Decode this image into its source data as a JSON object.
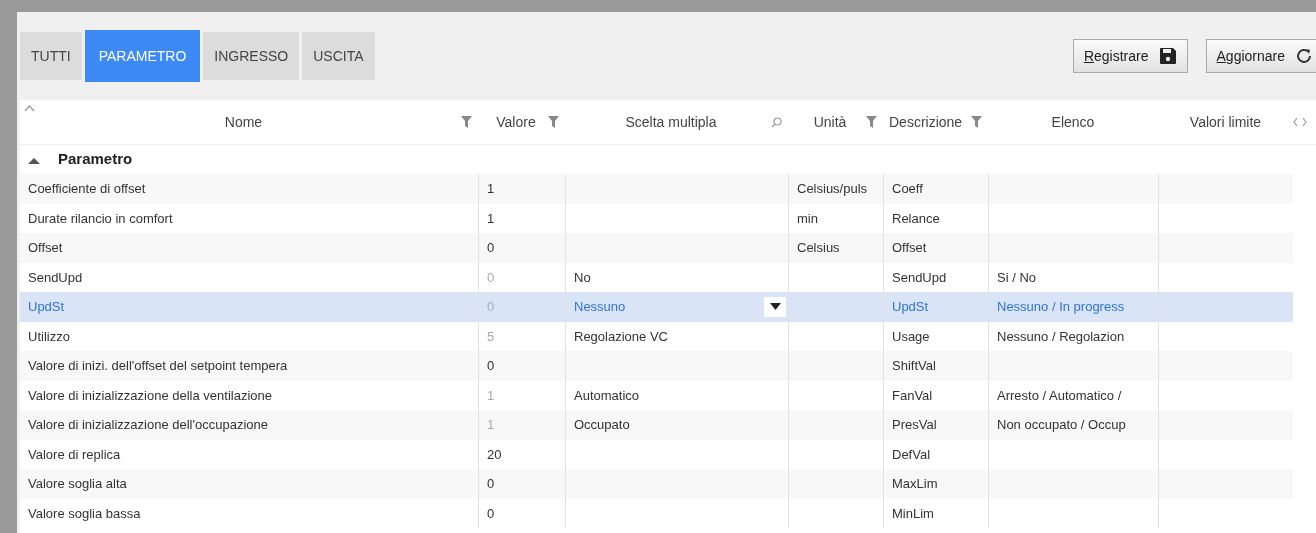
{
  "tabs": [
    {
      "label": "TUTTI",
      "selected": false
    },
    {
      "label": "PARAMETRO",
      "selected": true
    },
    {
      "label": "INGRESSO",
      "selected": false
    },
    {
      "label": "USCITA",
      "selected": false
    }
  ],
  "actions": [
    {
      "label": "Registrare",
      "kind": "save"
    },
    {
      "label": "Aggiornare",
      "kind": "refresh"
    }
  ],
  "table": {
    "columns": [
      {
        "label": "Nome",
        "kind": "filter"
      },
      {
        "label": "Valore",
        "kind": "filter"
      },
      {
        "label": "Scelta multipla",
        "kind": "search"
      },
      {
        "label": "Unità",
        "kind": "filter"
      },
      {
        "label": "Descrizione",
        "kind": "filter"
      },
      {
        "label": "Elenco",
        "kind": "plain"
      },
      {
        "label": "Valori limite",
        "kind": "plain"
      }
    ],
    "group": {
      "label": "Parametro",
      "expanded": true
    },
    "rows": [
      {
        "cells": [
          "Coefficiente di offset",
          "1",
          "",
          "Celsius/puls",
          "Coeff",
          "",
          ""
        ],
        "dimmed": false,
        "selected": false
      },
      {
        "cells": [
          "Durate rilancio in comfort",
          "1",
          "",
          "min",
          "Relance",
          "",
          ""
        ],
        "dimmed": false,
        "selected": false
      },
      {
        "cells": [
          "Offset",
          "0",
          "",
          "Celsius",
          "Offset",
          "",
          ""
        ],
        "dimmed": false,
        "selected": false
      },
      {
        "cells": [
          "SendUpd",
          "0",
          "No",
          "",
          "SendUpd",
          "Si / No",
          ""
        ],
        "dimmed": true,
        "selected": false
      },
      {
        "cells": [
          "UpdSt",
          "0",
          "Nessuno",
          "",
          "UpdSt",
          "Nessuno / In progress",
          ""
        ],
        "dimmed": true,
        "selected": true
      },
      {
        "cells": [
          "Utilizzo",
          "5",
          "Regolazione VC",
          "",
          "Usage",
          "Nessuno / Regolazion",
          ""
        ],
        "dimmed": true,
        "selected": false
      },
      {
        "cells": [
          "Valore di inizi.  dell'offset del setpoint tempera",
          "0",
          "",
          "",
          "ShiftVal",
          "",
          ""
        ],
        "dimmed": false,
        "selected": false
      },
      {
        "cells": [
          "Valore di inizializzazione della ventilazione",
          "1",
          "Automatico",
          "",
          "FanVal",
          "Arresto / Automatico /",
          ""
        ],
        "dimmed": true,
        "selected": false
      },
      {
        "cells": [
          "Valore di inizializzazione dell'occupazione",
          "1",
          "Occupato",
          "",
          "PresVal",
          "Non occupato / Occup",
          ""
        ],
        "dimmed": true,
        "selected": false
      },
      {
        "cells": [
          "Valore di replica",
          "20",
          "",
          "",
          "DefVal",
          "",
          ""
        ],
        "dimmed": false,
        "selected": false
      },
      {
        "cells": [
          "Valore soglia alta",
          "0",
          "",
          "",
          "MaxLim",
          "",
          ""
        ],
        "dimmed": false,
        "selected": false
      },
      {
        "cells": [
          "Valore soglia bassa",
          "0",
          "",
          "",
          "MinLim",
          "",
          ""
        ],
        "dimmed": false,
        "selected": false
      }
    ]
  }
}
